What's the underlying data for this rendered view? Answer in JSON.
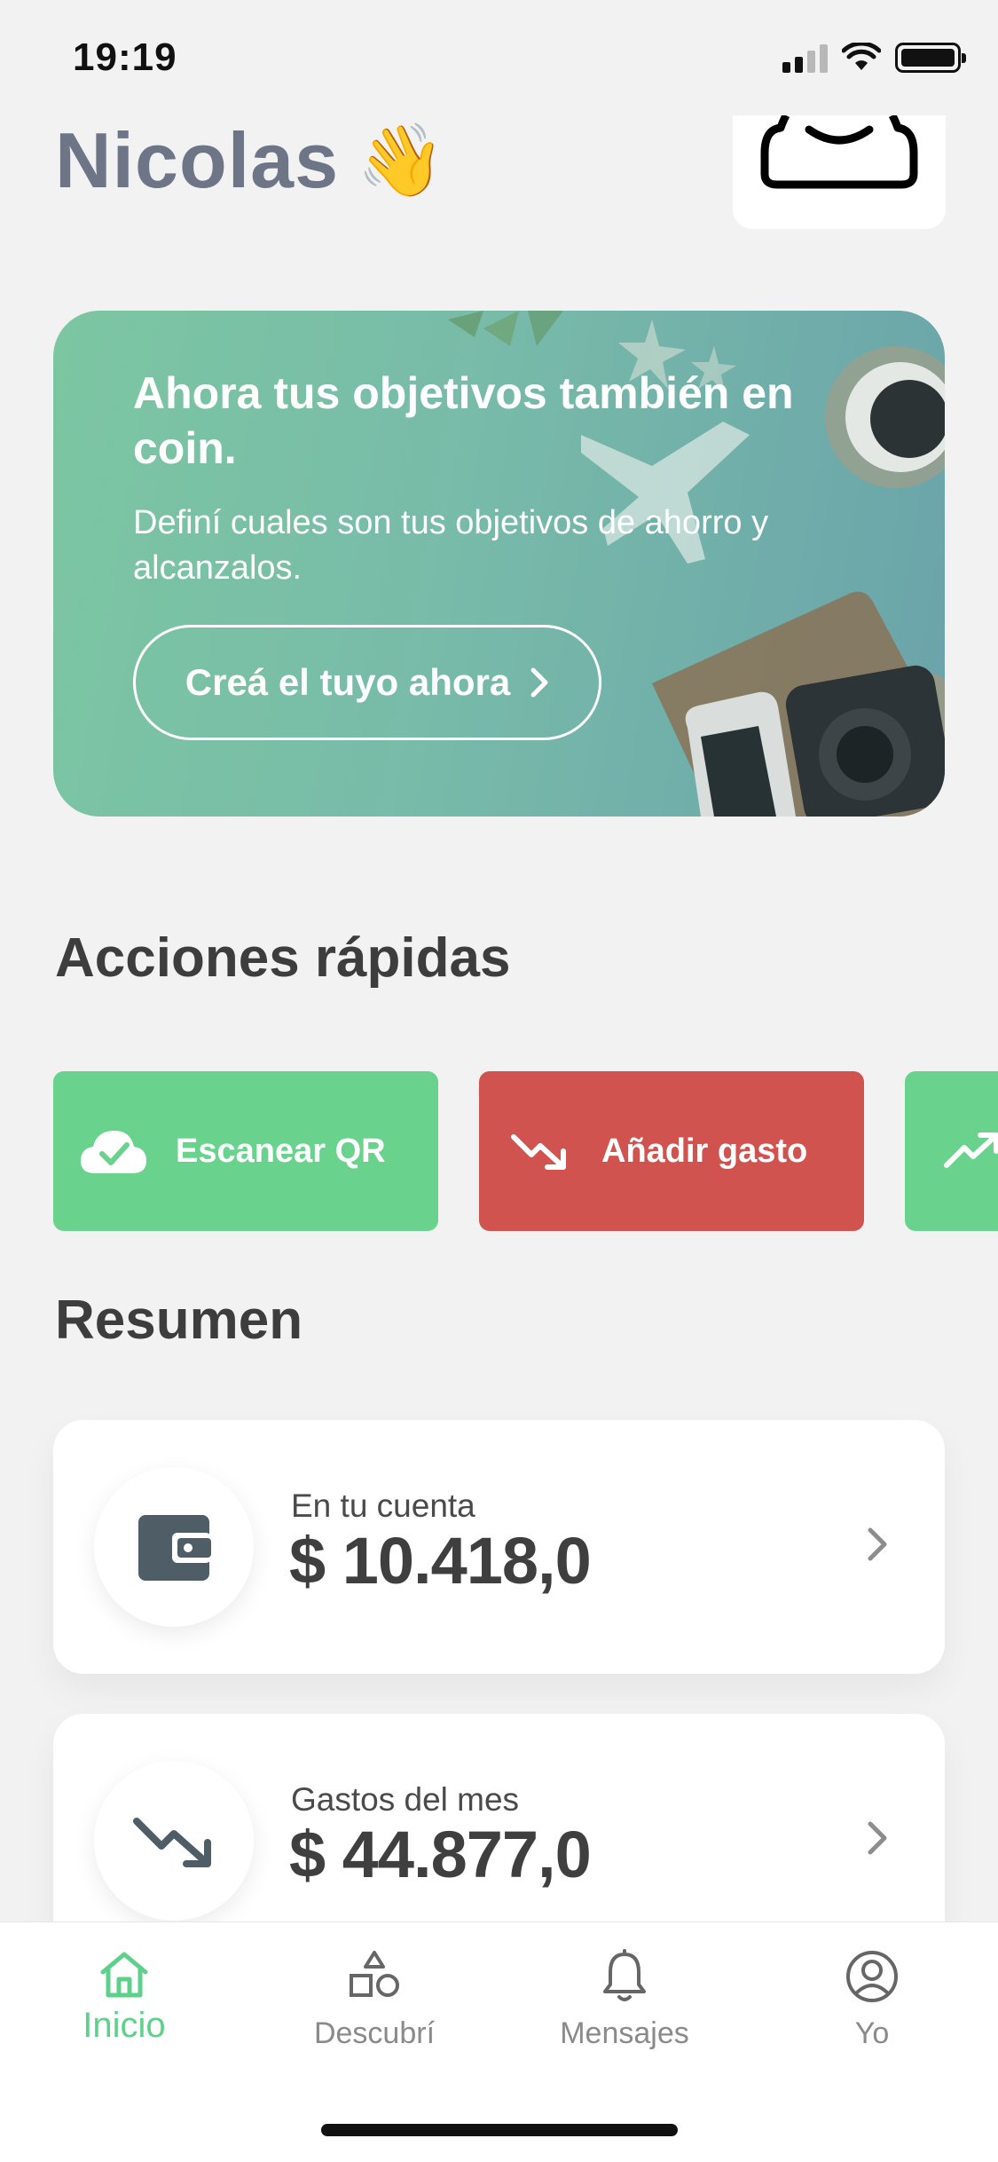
{
  "status_bar": {
    "time": "19:19"
  },
  "header": {
    "name": "Nicolas",
    "wave_emoji": "👋"
  },
  "promo": {
    "title": "Ahora tus objetivos también en coin.",
    "text": "Definí cuales son tus objetivos de ahorro y alcanzalos.",
    "button_label": "Creá el tuyo ahora",
    "colors": {
      "start": "#7cc6a2",
      "end": "#6aa3aa"
    }
  },
  "quick_actions": {
    "title": "Acciones rápidas",
    "items": [
      {
        "label": "Escanear QR",
        "icon": "cloud-check-icon",
        "color": "#69d38e"
      },
      {
        "label": "Añadir gasto",
        "icon": "trend-down-icon",
        "color": "#d1534f"
      },
      {
        "label": "",
        "icon": "trend-up-icon",
        "color": "#69d38e"
      }
    ]
  },
  "summary": {
    "title": "Resumen",
    "cards": [
      {
        "label": "En tu cuenta",
        "value": "$ 10.418,0",
        "icon": "wallet-icon"
      },
      {
        "label": "Gastos del mes",
        "value": "$ 44.877,0",
        "icon": "trend-down-icon"
      }
    ]
  },
  "tab_bar": {
    "active_color": "#5fd08b",
    "items": [
      {
        "label": "Inicio",
        "icon": "home-icon",
        "active": true
      },
      {
        "label": "Descubrí",
        "icon": "shapes-icon",
        "active": false
      },
      {
        "label": "Mensajes",
        "icon": "bell-icon",
        "active": false
      },
      {
        "label": "Yo",
        "icon": "user-circle-icon",
        "active": false
      }
    ]
  }
}
